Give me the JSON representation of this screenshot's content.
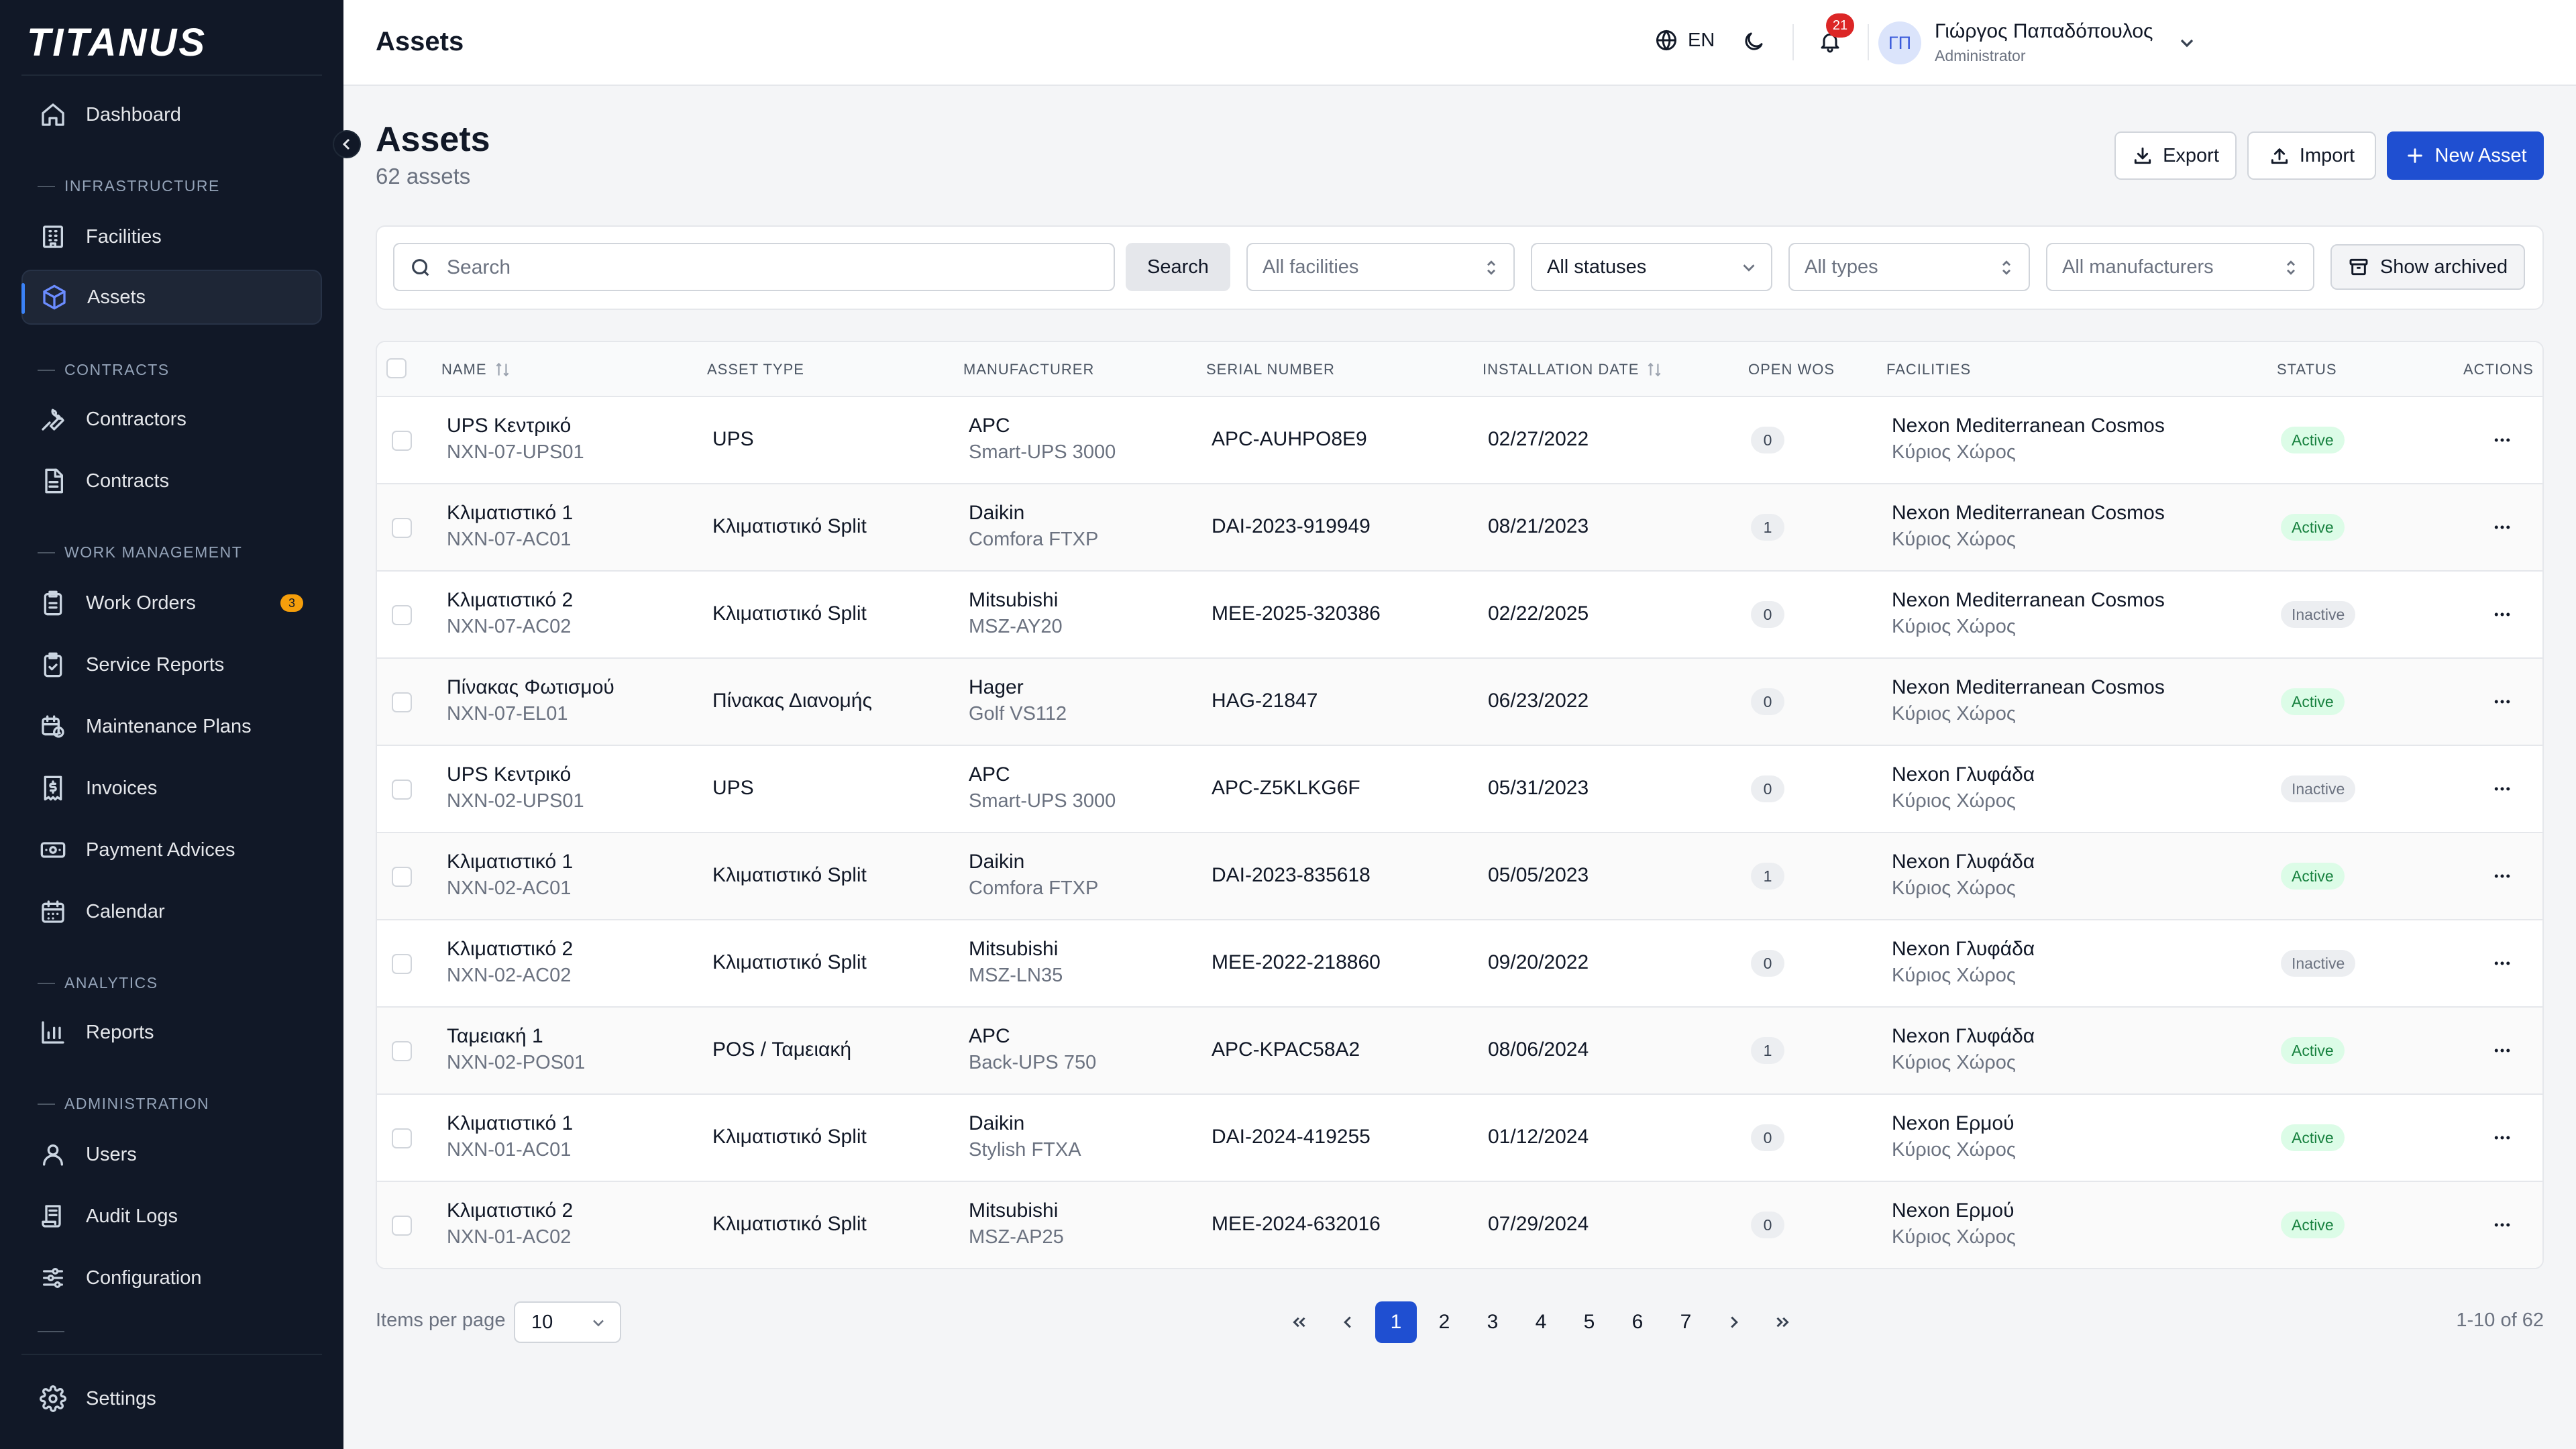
{
  "app": {
    "logo": "TITANUS"
  },
  "sidebar": {
    "dashboard": "Dashboard",
    "sections": {
      "infrastructure": "INFRASTRUCTURE",
      "contracts": "CONTRACTS",
      "work_management": "WORK MANAGEMENT",
      "analytics": "ANALYTICS",
      "administration": "ADMINISTRATION"
    },
    "items": {
      "facilities": "Facilities",
      "assets": "Assets",
      "contractors": "Contractors",
      "contracts": "Contracts",
      "work_orders": "Work Orders",
      "work_orders_badge": "3",
      "service_reports": "Service Reports",
      "maintenance_plans": "Maintenance Plans",
      "invoices": "Invoices",
      "payment_advices": "Payment Advices",
      "calendar": "Calendar",
      "reports": "Reports",
      "users": "Users",
      "audit_logs": "Audit Logs",
      "configuration": "Configuration",
      "settings": "Settings"
    },
    "active": "Assets"
  },
  "topbar": {
    "title": "Assets",
    "language": "EN",
    "notifications_count": "21",
    "user": {
      "initials": "ΓΠ",
      "name": "Γιώργος Παπαδόπουλος",
      "role": "Administrator"
    }
  },
  "page": {
    "title": "Assets",
    "subtitle": "62 assets",
    "export_label": "Export",
    "import_label": "Import",
    "new_label": "New Asset"
  },
  "filters": {
    "search_placeholder": "Search",
    "search_value": "",
    "search_button": "Search",
    "facilities": "All facilities",
    "statuses": "All statuses",
    "types": "All types",
    "manufacturers": "All manufacturers",
    "archived": "Show archived"
  },
  "table": {
    "headers": {
      "name": "NAME",
      "asset_type": "ASSET TYPE",
      "manufacturer": "MANUFACTURER",
      "serial": "SERIAL NUMBER",
      "install_date": "INSTALLATION DATE",
      "open_wos": "OPEN WOS",
      "facilities": "FACILITIES",
      "status": "STATUS",
      "actions": "ACTIONS"
    },
    "rows": [
      {
        "name": "UPS Κεντρικό",
        "code": "NXN-07-UPS01",
        "type": "UPS",
        "manufacturer": "APC",
        "model": "Smart-UPS 3000",
        "serial": "APC-AUHPO8E9",
        "date": "02/27/2022",
        "open_wos": "0",
        "facility": "Nexon Mediterranean Cosmos",
        "space": "Κύριος Χώρος",
        "status": "Active"
      },
      {
        "name": "Κλιματιστικό 1",
        "code": "NXN-07-AC01",
        "type": "Κλιματιστικό Split",
        "manufacturer": "Daikin",
        "model": "Comfora FTXP",
        "serial": "DAI-2023-919949",
        "date": "08/21/2023",
        "open_wos": "1",
        "facility": "Nexon Mediterranean Cosmos",
        "space": "Κύριος Χώρος",
        "status": "Active"
      },
      {
        "name": "Κλιματιστικό 2",
        "code": "NXN-07-AC02",
        "type": "Κλιματιστικό Split",
        "manufacturer": "Mitsubishi",
        "model": "MSZ-AY20",
        "serial": "MEE-2025-320386",
        "date": "02/22/2025",
        "open_wos": "0",
        "facility": "Nexon Mediterranean Cosmos",
        "space": "Κύριος Χώρος",
        "status": "Inactive"
      },
      {
        "name": "Πίνακας Φωτισμού",
        "code": "NXN-07-EL01",
        "type": "Πίνακας Διανομής",
        "manufacturer": "Hager",
        "model": "Golf VS112",
        "serial": "HAG-21847",
        "date": "06/23/2022",
        "open_wos": "0",
        "facility": "Nexon Mediterranean Cosmos",
        "space": "Κύριος Χώρος",
        "status": "Active"
      },
      {
        "name": "UPS Κεντρικό",
        "code": "NXN-02-UPS01",
        "type": "UPS",
        "manufacturer": "APC",
        "model": "Smart-UPS 3000",
        "serial": "APC-Z5KLKG6F",
        "date": "05/31/2023",
        "open_wos": "0",
        "facility": "Nexon Γλυφάδα",
        "space": "Κύριος Χώρος",
        "status": "Inactive"
      },
      {
        "name": "Κλιματιστικό 1",
        "code": "NXN-02-AC01",
        "type": "Κλιματιστικό Split",
        "manufacturer": "Daikin",
        "model": "Comfora FTXP",
        "serial": "DAI-2023-835618",
        "date": "05/05/2023",
        "open_wos": "1",
        "facility": "Nexon Γλυφάδα",
        "space": "Κύριος Χώρος",
        "status": "Active"
      },
      {
        "name": "Κλιματιστικό 2",
        "code": "NXN-02-AC02",
        "type": "Κλιματιστικό Split",
        "manufacturer": "Mitsubishi",
        "model": "MSZ-LN35",
        "serial": "MEE-2022-218860",
        "date": "09/20/2022",
        "open_wos": "0",
        "facility": "Nexon Γλυφάδα",
        "space": "Κύριος Χώρος",
        "status": "Inactive"
      },
      {
        "name": "Ταμειακή 1",
        "code": "NXN-02-POS01",
        "type": "POS / Ταμειακή",
        "manufacturer": "APC",
        "model": "Back-UPS 750",
        "serial": "APC-KPAC58A2",
        "date": "08/06/2024",
        "open_wos": "1",
        "facility": "Nexon Γλυφάδα",
        "space": "Κύριος Χώρος",
        "status": "Active"
      },
      {
        "name": "Κλιματιστικό 1",
        "code": "NXN-01-AC01",
        "type": "Κλιματιστικό Split",
        "manufacturer": "Daikin",
        "model": "Stylish FTXA",
        "serial": "DAI-2024-419255",
        "date": "01/12/2024",
        "open_wos": "0",
        "facility": "Nexon Ερμού",
        "space": "Κύριος Χώρος",
        "status": "Active"
      },
      {
        "name": "Κλιματιστικό 2",
        "code": "NXN-01-AC02",
        "type": "Κλιματιστικό Split",
        "manufacturer": "Mitsubishi",
        "model": "MSZ-AP25",
        "serial": "MEE-2024-632016",
        "date": "07/29/2024",
        "open_wos": "0",
        "facility": "Nexon Ερμού",
        "space": "Κύριος Χώρος",
        "status": "Active"
      }
    ]
  },
  "pagination": {
    "items_per_page_label": "Items per page",
    "items_per_page": "10",
    "pages": [
      "1",
      "2",
      "3",
      "4",
      "5",
      "6",
      "7"
    ],
    "current_page": "1",
    "range": "1-10 of 62"
  },
  "colors": {
    "sidebar_bg": "#111827",
    "primary": "#1f4fd1",
    "active_status": "#15803d",
    "badge_warning": "#f59e0b",
    "badge_alert": "#dc2626"
  }
}
